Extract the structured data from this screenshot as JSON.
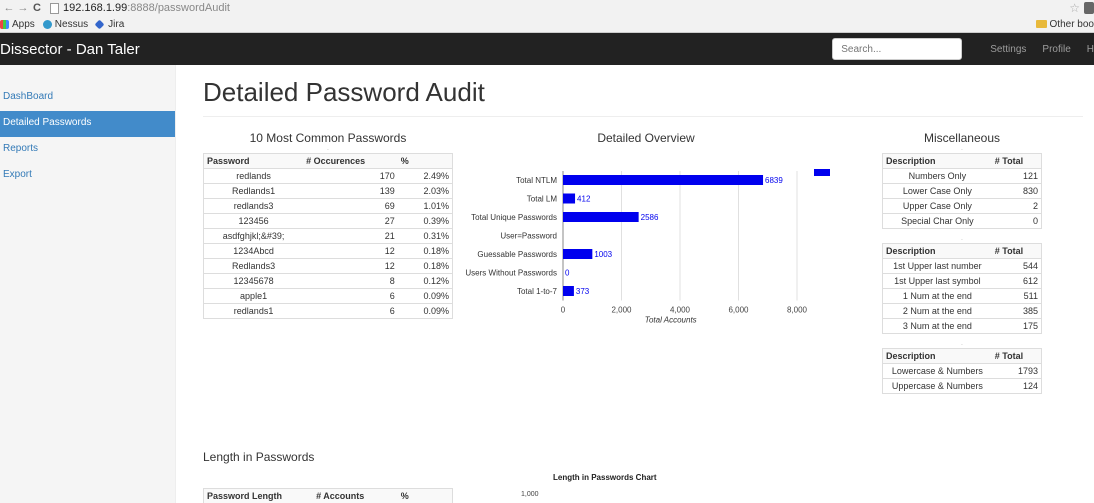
{
  "browser": {
    "url_host": "192.168.1.99",
    "url_path": ":8888/passwordAudit",
    "bookmarks": [
      "Apps",
      "Nessus",
      "Jira"
    ],
    "other_bookmarks": "Other boo"
  },
  "navbar": {
    "brand": "Dissector - Dan Taler",
    "search_placeholder": "Search...",
    "links": [
      "Settings",
      "Profile",
      "H"
    ]
  },
  "sidebar": {
    "items": [
      {
        "label": "DashBoard",
        "active": false
      },
      {
        "label": "Detailed Passwords",
        "active": true
      },
      {
        "label": "Reports",
        "active": false
      },
      {
        "label": "Export",
        "active": false
      }
    ]
  },
  "page_title": "Detailed Password Audit",
  "common_passwords": {
    "title": "10 Most Common Passwords",
    "headers": [
      "Password",
      "# Occurences",
      "%"
    ],
    "rows": [
      [
        "redlands",
        "170",
        "2.49%"
      ],
      [
        "Redlands1",
        "139",
        "2.03%"
      ],
      [
        "redlands3",
        "69",
        "1.01%"
      ],
      [
        "123456",
        "27",
        "0.39%"
      ],
      [
        "asdfghjkl;&#39;",
        "21",
        "0.31%"
      ],
      [
        "1234Abcd",
        "12",
        "0.18%"
      ],
      [
        "Redlands3",
        "12",
        "0.18%"
      ],
      [
        "12345678",
        "8",
        "0.12%"
      ],
      [
        "apple1",
        "6",
        "0.09%"
      ],
      [
        "redlands1",
        "6",
        "0.09%"
      ]
    ]
  },
  "overview": {
    "title": "Detailed Overview",
    "chart_data": {
      "type": "bar",
      "orientation": "horizontal",
      "categories": [
        "Total NTLM",
        "Total LM",
        "Total Unique Passwords",
        "User=Password",
        "Guessable Passwords",
        "Users Without Passwords",
        "Total 1-to-7"
      ],
      "values": [
        6839,
        412,
        2586,
        0,
        1003,
        0,
        373
      ],
      "value_labels": [
        "6839",
        "412",
        "2586",
        "",
        "1003",
        "0",
        "373"
      ],
      "xlabel": "Total Accounts",
      "xticks": [
        "0",
        "2,000",
        "4,000",
        "6,000",
        "8,000"
      ],
      "xlim": [
        0,
        8000
      ],
      "bar_color": "#0000ee",
      "grid": true,
      "legend_swatch": true
    }
  },
  "misc": {
    "title": "Miscellaneous",
    "tables": [
      {
        "headers": [
          "Description",
          "# Total"
        ],
        "rows": [
          [
            "Numbers Only",
            "121"
          ],
          [
            "Lower Case Only",
            "830"
          ],
          [
            "Upper Case Only",
            "2"
          ],
          [
            "Special Char Only",
            "0"
          ]
        ]
      },
      {
        "headers": [
          "Description",
          "# Total"
        ],
        "rows": [
          [
            "1st Upper last number",
            "544"
          ],
          [
            "1st Upper last symbol",
            "612"
          ],
          [
            "1 Num at the end",
            "511"
          ],
          [
            "2 Num at the end",
            "385"
          ],
          [
            "3 Num at the end",
            "175"
          ]
        ]
      },
      {
        "headers": [
          "Description",
          "# Total"
        ],
        "rows": [
          [
            "Lowercase & Numbers",
            "1793"
          ],
          [
            "Uppercase & Numbers",
            "124"
          ]
        ]
      }
    ]
  },
  "length": {
    "title": "Length in Passwords",
    "headers": [
      "Password Length",
      "# Accounts",
      "%"
    ],
    "chart_title": "Length in Passwords Chart",
    "chart_ytick_top": "1,000"
  },
  "colors": {
    "navbar": "#222222",
    "sidebar_active": "#428bca",
    "link": "#337ab7",
    "bar": "#0000ee"
  }
}
